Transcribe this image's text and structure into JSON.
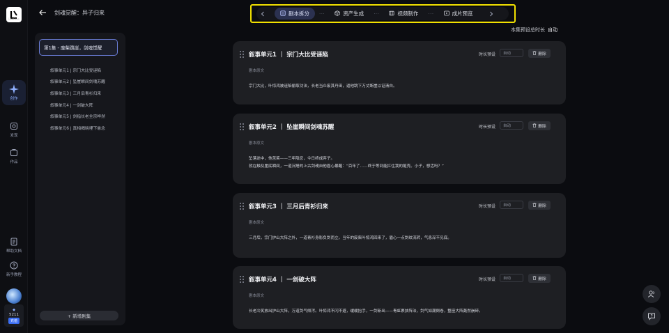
{
  "rail": {
    "logo_text": "LeoRise",
    "items": [
      {
        "label": "创作",
        "icon": "sparkle-icon"
      },
      {
        "label": "发现",
        "icon": "discover-icon"
      },
      {
        "label": "作品",
        "icon": "works-icon"
      },
      {
        "label": "帮助文档",
        "icon": "help-doc-icon"
      },
      {
        "label": "新手教程",
        "icon": "tutorial-icon"
      }
    ],
    "credits": "5211",
    "recharge": "充值"
  },
  "header": {
    "title": "剑魂觉醒：异子归来"
  },
  "stepper": {
    "steps": [
      {
        "label": "剧本拆分",
        "active": true
      },
      {
        "label": "资产生成",
        "active": false
      },
      {
        "label": "视频制作",
        "active": false
      },
      {
        "label": "成片预览",
        "active": false
      }
    ],
    "dots": "···"
  },
  "global_duration": {
    "label": "本集预设总时长",
    "value": "自动"
  },
  "episode_panel": {
    "selected": "第1集 - 废柴跳崖，剑魂觉醒",
    "units": [
      "叙事单元1 | 宗门大比受诬陷",
      "叙事单元2 | 坠崖瞬间剑魂苏醒",
      "叙事单元3 | 三月后青衫归来",
      "叙事单元4 | 一剑破大阵",
      "叙事单元5 | 剑指长老全宗哗然",
      "叙事单元6 | 真相揭晓埋下悬念"
    ],
    "add_label": "+ 新增剧集"
  },
  "cards": [
    {
      "title": "叙事单元1 ｜ 宗门大比受诬陷",
      "duration_label": "时长预设",
      "duration_placeholder": "自动",
      "delete_label": "删除",
      "subtitle": "剧本原文",
      "text": [
        "宗门大比，叶惊鸿被诬陷偷取功法，长老当众废其丹田，逼他跳下万丈断崖以证清白。"
      ]
    },
    {
      "title": "叙事单元2 ｜ 坠崖瞬间剑魂苏醒",
      "duration_label": "时长预设",
      "duration_placeholder": "自动",
      "delete_label": "删除",
      "subtitle": "剧本原文",
      "text": [
        "坠落途中，他苦笑——三年隐忍，今日终成弃子。",
        "就在触及崖底瞬间，一道沉睡的上古剑魂自他眉心暴醒：“百年了……终于等到能扛住我的躯壳。小子，想活吗？”"
      ]
    },
    {
      "title": "叙事单元3 ｜ 三月后青衫归来",
      "duration_label": "时长预设",
      "duration_placeholder": "自动",
      "delete_label": "删除",
      "subtitle": "剧本原文",
      "text": [
        "三月后，宗门护山大阵之外，一道青衫身影负剑而立。当年的废柴叶惊鸿回来了，眉心一点剑纹流转，气息深不见底。"
      ]
    },
    {
      "title": "叙事单元4 ｜ 一剑破大阵",
      "duration_label": "时长预设",
      "duration_placeholder": "自动",
      "delete_label": "删除",
      "subtitle": "剧本原文",
      "text": [
        "长老冷笑放出护山大阵，万道剑气倾泻。叶惊鸿不闪不避，缓缓抬手，一剑斩出——青虹裹挟阵法，剑气如潮倒卷，整座大阵轰然崩碎。"
      ]
    }
  ]
}
